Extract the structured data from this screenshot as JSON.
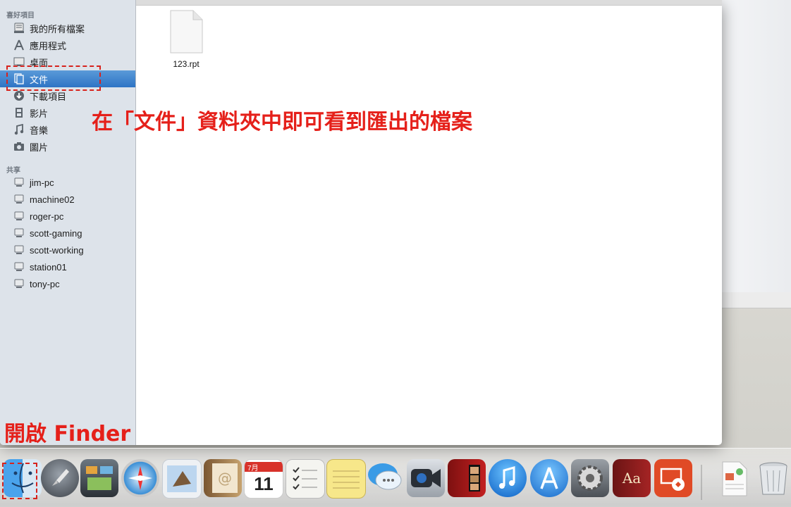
{
  "sidebar": {
    "favorites_header": "喜好項目",
    "favorites": [
      {
        "label": "我的所有檔案",
        "icon": "all-files-icon"
      },
      {
        "label": "應用程式",
        "icon": "applications-icon"
      },
      {
        "label": "桌面",
        "icon": "desktop-icon"
      },
      {
        "label": "文件",
        "icon": "documents-icon",
        "selected": true
      },
      {
        "label": "下載項目",
        "icon": "downloads-icon"
      },
      {
        "label": "影片",
        "icon": "movies-icon"
      },
      {
        "label": "音樂",
        "icon": "music-icon"
      },
      {
        "label": "圖片",
        "icon": "pictures-icon"
      }
    ],
    "shared_header": "共享",
    "shared": [
      {
        "label": "jim-pc",
        "icon": "computer-icon"
      },
      {
        "label": "machine02",
        "icon": "computer-icon"
      },
      {
        "label": "roger-pc",
        "icon": "computer-icon"
      },
      {
        "label": "scott-gaming",
        "icon": "computer-icon"
      },
      {
        "label": "scott-working",
        "icon": "computer-icon"
      },
      {
        "label": "station01",
        "icon": "computer-icon"
      },
      {
        "label": "tony-pc",
        "icon": "computer-icon"
      }
    ]
  },
  "content": {
    "files": [
      {
        "name": "123.rpt",
        "icon": "document-file-icon"
      }
    ]
  },
  "annotations": {
    "documents_note": "在「文件」資料夾中即可看到匯出的檔案",
    "finder_note": "開啟 Finder",
    "color": "#e5201a"
  },
  "dock": {
    "items": [
      "finder-icon",
      "launchpad-icon",
      "mission-control-icon",
      "safari-icon",
      "mail-icon",
      "contacts-icon",
      "calendar-icon",
      "reminders-icon",
      "notes-icon",
      "messages-icon",
      "facetime-icon",
      "photo-booth-icon",
      "itunes-icon",
      "app-store-icon",
      "system-preferences-icon",
      "dictionary-icon",
      "remote-desktop-icon",
      "document-icon",
      "trash-icon"
    ],
    "calendar": {
      "month": "7月",
      "day": "11"
    },
    "dictionary_label": "Aa"
  },
  "colors": {
    "selection": "#3a80cf",
    "sidebar_bg": "#dde3ea"
  }
}
